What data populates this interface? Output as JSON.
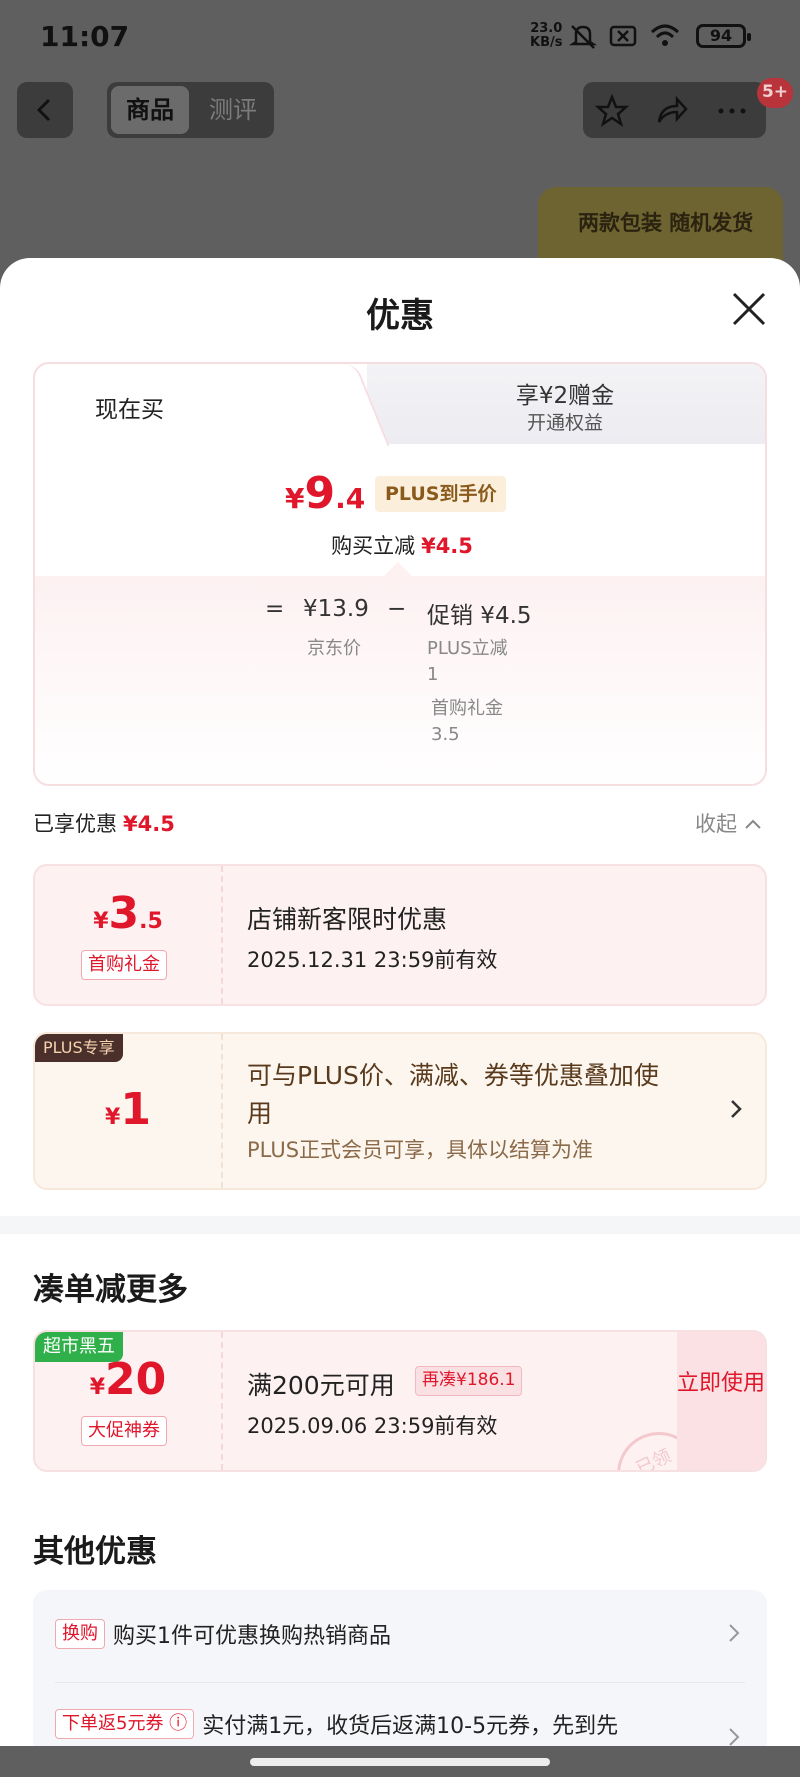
{
  "status_bar": {
    "time": "11:07",
    "net_speed": "23.0",
    "net_unit": "KB/s",
    "battery": "94"
  },
  "header": {
    "tab_goods": "商品",
    "tab_review": "测评",
    "cart_badge": "5+",
    "banner_text": "两款包装 随机发货"
  },
  "sheet": {
    "title": "优惠",
    "price_card": {
      "tab_now": "现在买",
      "tab_bonus_title": "享¥2赠金",
      "tab_bonus_sub": "开通权益",
      "currency": "¥",
      "final_int": "9",
      "final_dec": ".4",
      "plus_tag": "PLUS到手价",
      "buy_reduce_label": "购买立减",
      "buy_reduce_value": "¥4.5",
      "eq": "=",
      "jd_price": "¥13.9",
      "minus": "−",
      "promo": "促销 ¥4.5",
      "jd_price_label": "京东价",
      "plus_reduce_label": "PLUS立减",
      "plus_reduce_value": "1",
      "first_gift_label": "首购礼金",
      "first_gift_value": "3.5"
    },
    "enjoyed": {
      "label": "已享优惠",
      "value": "¥4.5",
      "collapse": "收起"
    },
    "coupon1": {
      "currency": "¥",
      "int": "3",
      "dec": ".5",
      "chip": "首购礼金",
      "title": "店铺新客限时优惠",
      "valid": "2025.12.31 23:59前有效"
    },
    "coupon2": {
      "tag": "PLUS专享",
      "currency": "¥",
      "int": "1",
      "title_line1": "可与PLUS价、满减、券等优惠叠加使",
      "title_line2": "用",
      "sub": "PLUS正式会员可享，具体以结算为准"
    },
    "section_more": "凑单减更多",
    "coupon3": {
      "tag": "超市黑五",
      "currency": "¥",
      "int": "20",
      "chip": "大促神券",
      "title": "满200元可用",
      "extra_chip": "再凑¥186.1",
      "valid": "2025.09.06 23:59前有效",
      "use_now": "立即使用",
      "stamp": "已领"
    },
    "section_other": "其他优惠",
    "other": {
      "row1_chip": "换购",
      "row1_text": "购买1件可优惠换购热销商品",
      "row2_chip": "下单返5元券 ⓘ",
      "row2_text": "实付满1元，收货后返满10-5元券，先到先"
    }
  },
  "colors": {
    "accent_red": "#e0162b",
    "plus_brown": "#5a3a1c",
    "green_tag": "#2fb04a"
  }
}
